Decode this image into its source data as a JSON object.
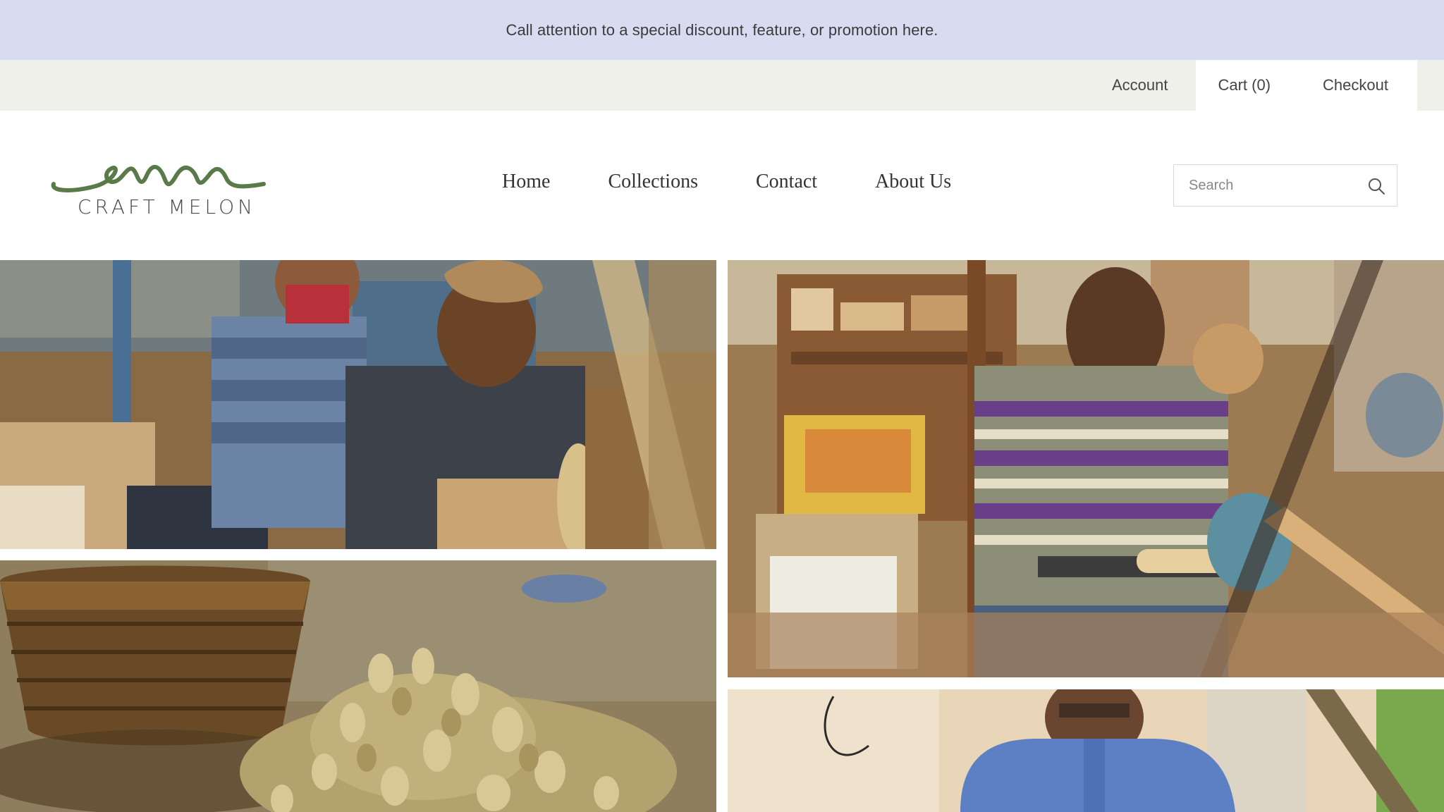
{
  "announcement": {
    "text": "Call attention to a special discount, feature, or promotion here."
  },
  "utility_nav": {
    "account": "Account",
    "cart": "Cart (0)",
    "checkout": "Checkout"
  },
  "brand": {
    "name": "CRAFT MELON",
    "color": "#5a7a4a"
  },
  "main_nav": {
    "items": [
      {
        "label": "Home"
      },
      {
        "label": "Collections"
      },
      {
        "label": "Contact"
      },
      {
        "label": "About Us"
      }
    ]
  },
  "search": {
    "placeholder": "Search",
    "icon": "search-icon"
  },
  "gallery": {
    "images": [
      {
        "subject": "Two craftsmen in caps working at a wood sanding wheel"
      },
      {
        "subject": "Craftsman in striped polo turning wood on a lathe in a cluttered workshop"
      },
      {
        "subject": "Pile of turned wooden chess pieces beside a woven basket"
      },
      {
        "subject": "Man with glasses in blue shirt at workshop"
      }
    ]
  },
  "colors": {
    "announcement_bg": "#d9dcf0",
    "utility_bg": "#f0f0eb",
    "logo_green": "#5a7a4a"
  }
}
